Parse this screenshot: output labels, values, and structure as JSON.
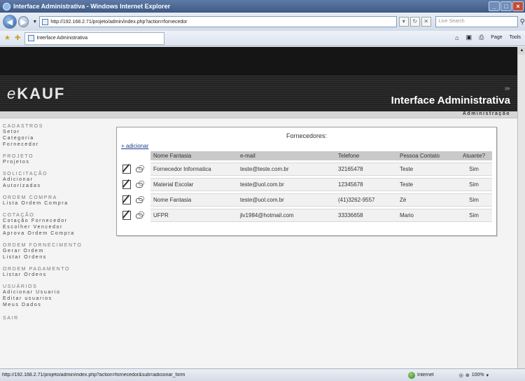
{
  "browser": {
    "window_title": "Interface Administrativa - Windows Internet Explorer",
    "address": "http://192.168.2.71/projeto/admin/index.php?action=fornecedor",
    "search_placeholder": "Live Search",
    "tab_label": "Interface Administrativa",
    "page_label": "Page",
    "tools_label": "Tools",
    "status_url": "http://192.168.2.71/projeto/admin/index.php?action=fornecedor&sub=adicionar_form",
    "status_zone": "Internet",
    "zoom": "100%"
  },
  "header": {
    "logo_prefix": "e",
    "logo_main": "KAUF",
    "title": "Interface Administrativa",
    "admin_link": "Administração"
  },
  "sidebar": {
    "groups": [
      {
        "title": "CADASTROS",
        "items": [
          "Setor",
          "Categoria",
          "Fornecedor"
        ]
      },
      {
        "title": "PROJETO",
        "items": [
          "Projetos"
        ]
      },
      {
        "title": "SOLICITAÇÃO",
        "items": [
          "Adicionar",
          "Autorizadas"
        ]
      },
      {
        "title": "ORDEM COMPRA",
        "items": [
          "Lista Ordem Compra"
        ]
      },
      {
        "title": "COTAÇÃO",
        "items": [
          "Cotação Fornecedor",
          "Escolher Vencedor",
          "Aprova Ordem Compra"
        ]
      },
      {
        "title": "ORDEM FORNECIMENTO",
        "items": [
          "Gerar Ordem",
          "Listar Ordens"
        ]
      },
      {
        "title": "ORDEM PAGAMENTO",
        "items": [
          "Listar Ordens"
        ]
      },
      {
        "title": "USUÁRIOS",
        "items": [
          "Adicionar Usuario",
          "Editar usuarios",
          "Meus Dados"
        ]
      },
      {
        "title": "SAIR",
        "items": []
      }
    ]
  },
  "panel": {
    "title": "Fornecedores:",
    "add_link": "+ adicionar",
    "columns": [
      "Nome Fantasia",
      "e-mail",
      "Telefone",
      "Pessoa Contato",
      "Atuante?"
    ],
    "rows": [
      [
        "Fornecedor Informatica",
        "teste@teste.com.br",
        "32165478",
        "Teste",
        "Sim"
      ],
      [
        "Material Escolar",
        "teste@uol.com.br",
        "12345678",
        "Teste",
        "Sim"
      ],
      [
        "Nome Fantasia",
        "teste@uol.com.br",
        "(41)3262-9557",
        "Zé",
        "Sim"
      ],
      [
        "UFPR",
        "jlv1984@hotmail.com",
        "33336658",
        "Mario",
        "Sim"
      ]
    ]
  },
  "icons": {
    "edit": "edit-icon",
    "link": "link-icon",
    "back": "back-arrow-icon",
    "forward": "forward-arrow-icon"
  }
}
